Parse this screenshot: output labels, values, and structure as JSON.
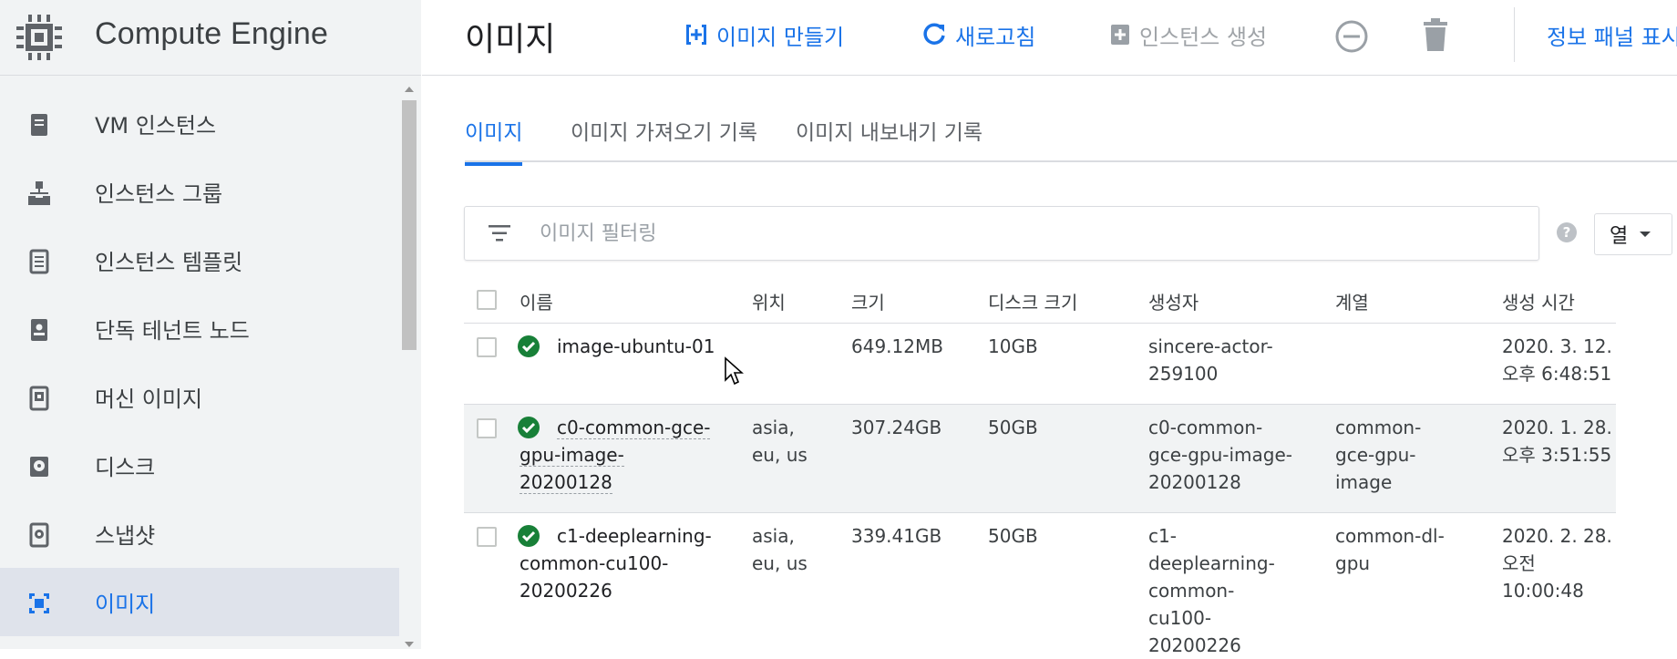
{
  "app": {
    "title": "Compute Engine",
    "logo_icon": "chip-icon"
  },
  "sidebar": {
    "items": [
      {
        "label": "VM 인스턴스",
        "icon": "vm-instance-icon"
      },
      {
        "label": "인스턴스 그룹",
        "icon": "instance-group-icon"
      },
      {
        "label": "인스턴스 템플릿",
        "icon": "instance-template-icon"
      },
      {
        "label": "단독 테넌트 노드",
        "icon": "sole-tenant-node-icon"
      },
      {
        "label": "머신 이미지",
        "icon": "machine-image-icon"
      },
      {
        "label": "디스크",
        "icon": "disk-icon"
      },
      {
        "label": "스냅샷",
        "icon": "snapshot-icon"
      },
      {
        "label": "이미지",
        "icon": "image-icon",
        "active": true
      }
    ]
  },
  "toolbar": {
    "page_title": "이미지",
    "create_image": "이미지 만들기",
    "refresh": "새로고침",
    "create_instance": "인스턴스 생성",
    "info_panel": "정보 패널 표시"
  },
  "tabs": [
    "이미지",
    "이미지 가져오기 기록",
    "이미지 내보내기 기록"
  ],
  "filter": {
    "placeholder": "이미지 필터링"
  },
  "columns_button": "열",
  "table": {
    "headers": [
      "이름",
      "위치",
      "크기",
      "디스크 크기",
      "생성자",
      "계열",
      "생성 시간"
    ],
    "rows": [
      {
        "name": [
          "image-ubuntu-01"
        ],
        "location": [],
        "size": "649.12MB",
        "disk_size": "10GB",
        "creator": [
          "sincere-actor-",
          "259100"
        ],
        "family": [],
        "created": [
          "2020. 3. 12.",
          "오후 6:48:51"
        ]
      },
      {
        "name": [
          "c0-common-gce-",
          "gpu-image-",
          "20200128"
        ],
        "location": [
          "asia,",
          "eu, us"
        ],
        "size": "307.24GB",
        "disk_size": "50GB",
        "creator": [
          "c0-common-",
          "gce-gpu-image-",
          "20200128"
        ],
        "family": [
          "common-",
          "gce-gpu-",
          "image"
        ],
        "created": [
          "2020. 1. 28.",
          "오후 3:51:55"
        ]
      },
      {
        "name": [
          "c1-deeplearning-",
          "common-cu100-",
          "20200226"
        ],
        "location": [
          "asia,",
          "eu, us"
        ],
        "size": "339.41GB",
        "disk_size": "50GB",
        "creator": [
          "c1-",
          "deeplearning-",
          "common-",
          "cu100-",
          "20200226"
        ],
        "family": [
          "common-dl-",
          "gpu"
        ],
        "created": [
          "2020. 2. 28.",
          "오전",
          "10:00:48"
        ]
      }
    ]
  },
  "colors": {
    "accent": "#1a73e8",
    "success": "#188038",
    "sidebar_bg": "#f1f3f4",
    "active_bg": "#dfe3eb"
  }
}
